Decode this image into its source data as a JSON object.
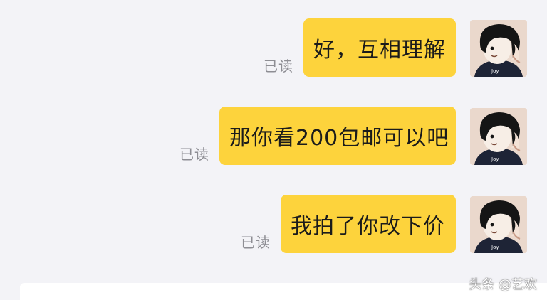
{
  "messages": [
    {
      "text": "好，互相理解",
      "status": "已读"
    },
    {
      "text": "那你看200包邮可以吧",
      "status": "已读"
    },
    {
      "text": "我拍了你改下价",
      "status": "已读"
    }
  ],
  "avatar": {
    "shirt_text": "Joy"
  },
  "watermark": "头条 @艺欢",
  "colors": {
    "bubble": "#fdd33c",
    "background": "#f3f3f7",
    "read_status": "#8e8e94"
  }
}
